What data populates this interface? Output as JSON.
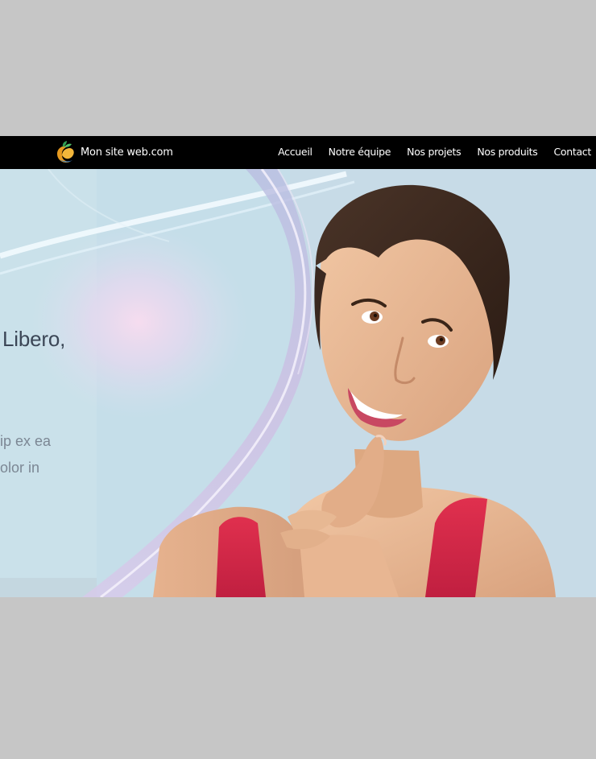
{
  "navbar": {
    "brand_name": "Mon site web.com",
    "brand_logo_icon": "leaf-swirl-logo-icon",
    "links": [
      {
        "label": "Accueil"
      },
      {
        "label": "Notre équipe"
      },
      {
        "label": "Nos projets"
      },
      {
        "label": "Nos produits"
      },
      {
        "label": "Contact"
      }
    ],
    "colors": {
      "background": "#000000",
      "text": "#ffffff"
    }
  },
  "hero": {
    "heading": "Libero,",
    "lines": [
      "ip ex ea",
      "olor in"
    ],
    "colors": {
      "heading": "#3b4656",
      "body_text": "#7c8794",
      "shirt": "#d9284a"
    }
  },
  "page": {
    "background": "#c6c6c6"
  }
}
